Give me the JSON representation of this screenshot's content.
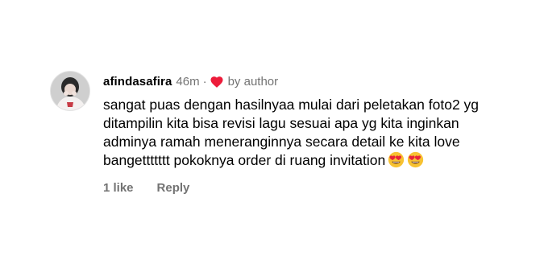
{
  "comment": {
    "username": "afindasafira",
    "time": "46m",
    "dot": "·",
    "liked_by": "by author",
    "text": "sangat puas dengan hasilnyaa mulai dari peletakan foto2 yg ditampilin kita bisa revisi lagu sesuai apa yg kita inginkan adminya ramah meneranginnya secara detail ke kita love bangettttttt pokoknya order di ruang invitation",
    "emojis": [
      "heart-eyes-emoji",
      "heart-eyes-emoji"
    ],
    "likes": "1 like",
    "reply_label": "Reply"
  },
  "colors": {
    "heart": "#ed1c3a",
    "muted_text": "#737373",
    "emoji_face": "#f7c232"
  }
}
